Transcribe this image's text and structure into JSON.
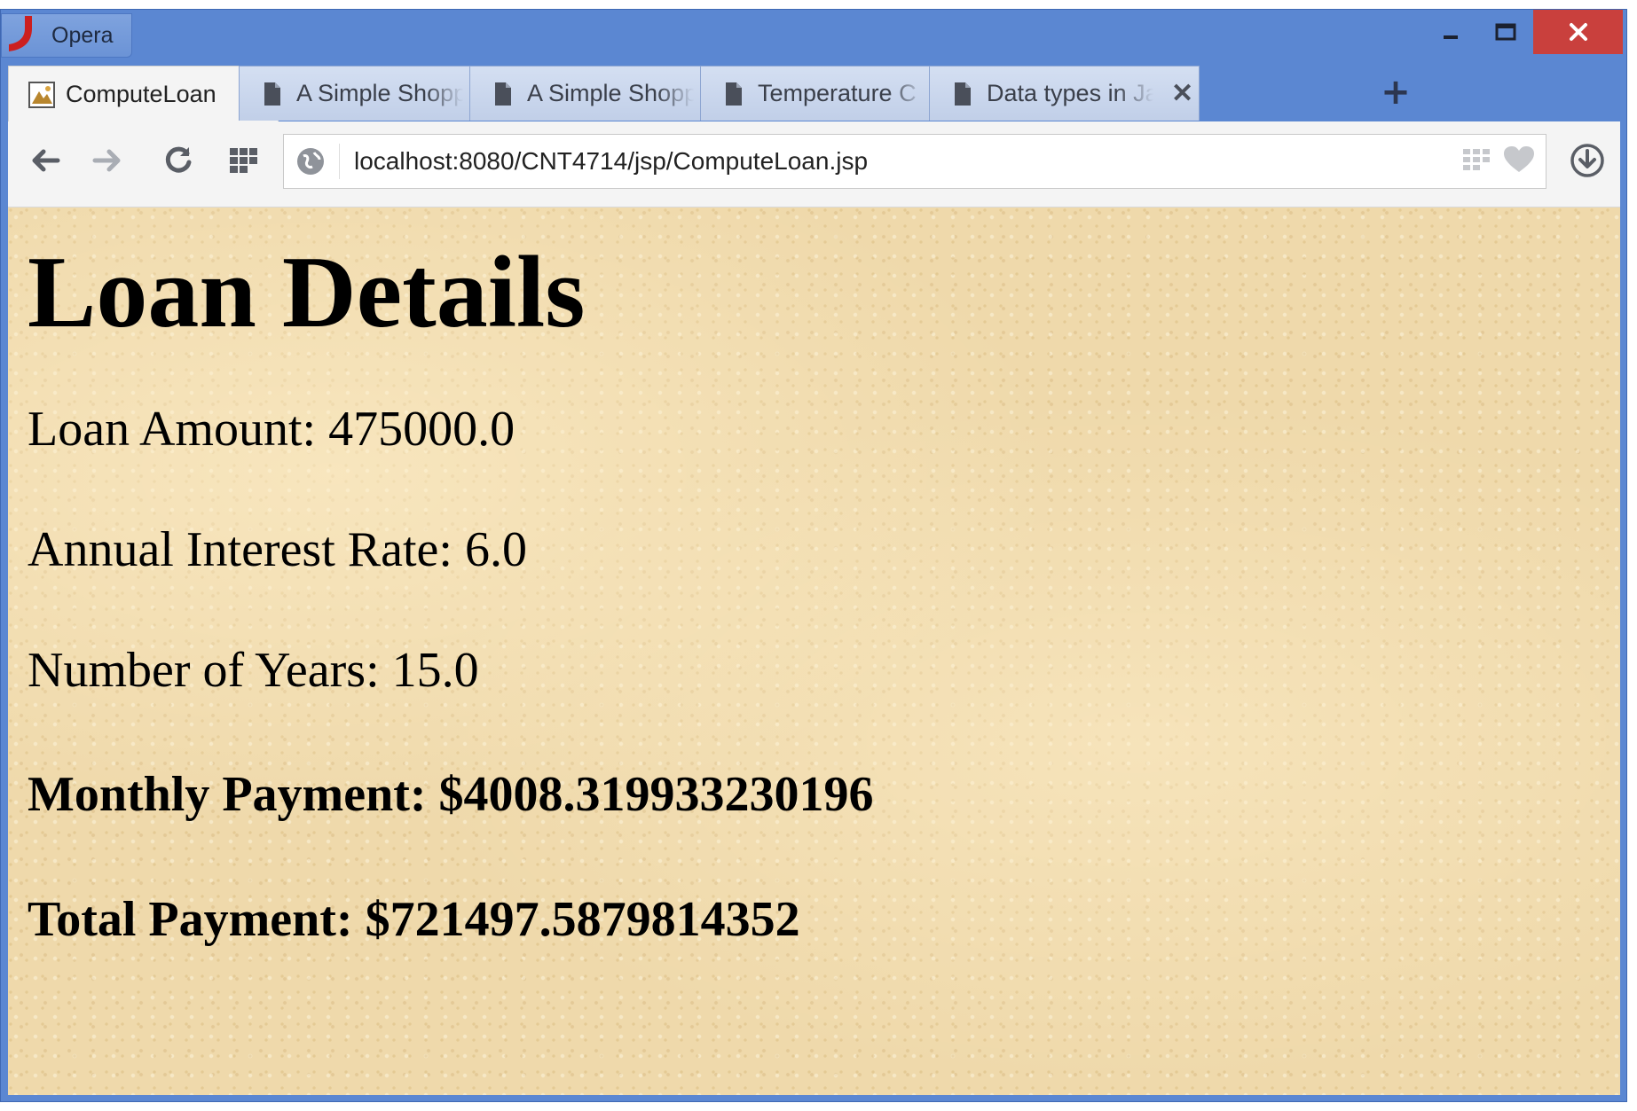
{
  "window": {
    "app_name": "Opera",
    "controls": {
      "minimize": "–",
      "maximize": "☐",
      "close": "✕"
    }
  },
  "tabs": [
    {
      "label": "ComputeLoan",
      "active": true,
      "icon": "page-image-icon"
    },
    {
      "label": "A Simple Shopp",
      "active": false,
      "icon": "document-icon"
    },
    {
      "label": "A Simple Shopp",
      "active": false,
      "icon": "document-icon"
    },
    {
      "label": "Temperature C",
      "active": false,
      "icon": "document-icon"
    },
    {
      "label": "Data types in Ja",
      "active": false,
      "icon": "document-icon"
    }
  ],
  "tab_close_glyph": "✕",
  "new_tab_glyph": "+",
  "address_bar": {
    "url": "localhost:8080/CNT4714/jsp/ComputeLoan.jsp"
  },
  "page": {
    "title": "Loan Details",
    "loan_amount": "Loan Amount: 475000.0",
    "interest_rate": "Annual Interest Rate: 6.0",
    "years": "Number of Years: 15.0",
    "monthly_payment": "Monthly Payment: $4008.319933230196",
    "total_payment": "Total Payment: $721497.5879814352"
  },
  "colors": {
    "frame": "#5b87d2",
    "close_button": "#c9403d",
    "page_background": "#efd9ab",
    "opera_red": "#cc1f1f"
  }
}
